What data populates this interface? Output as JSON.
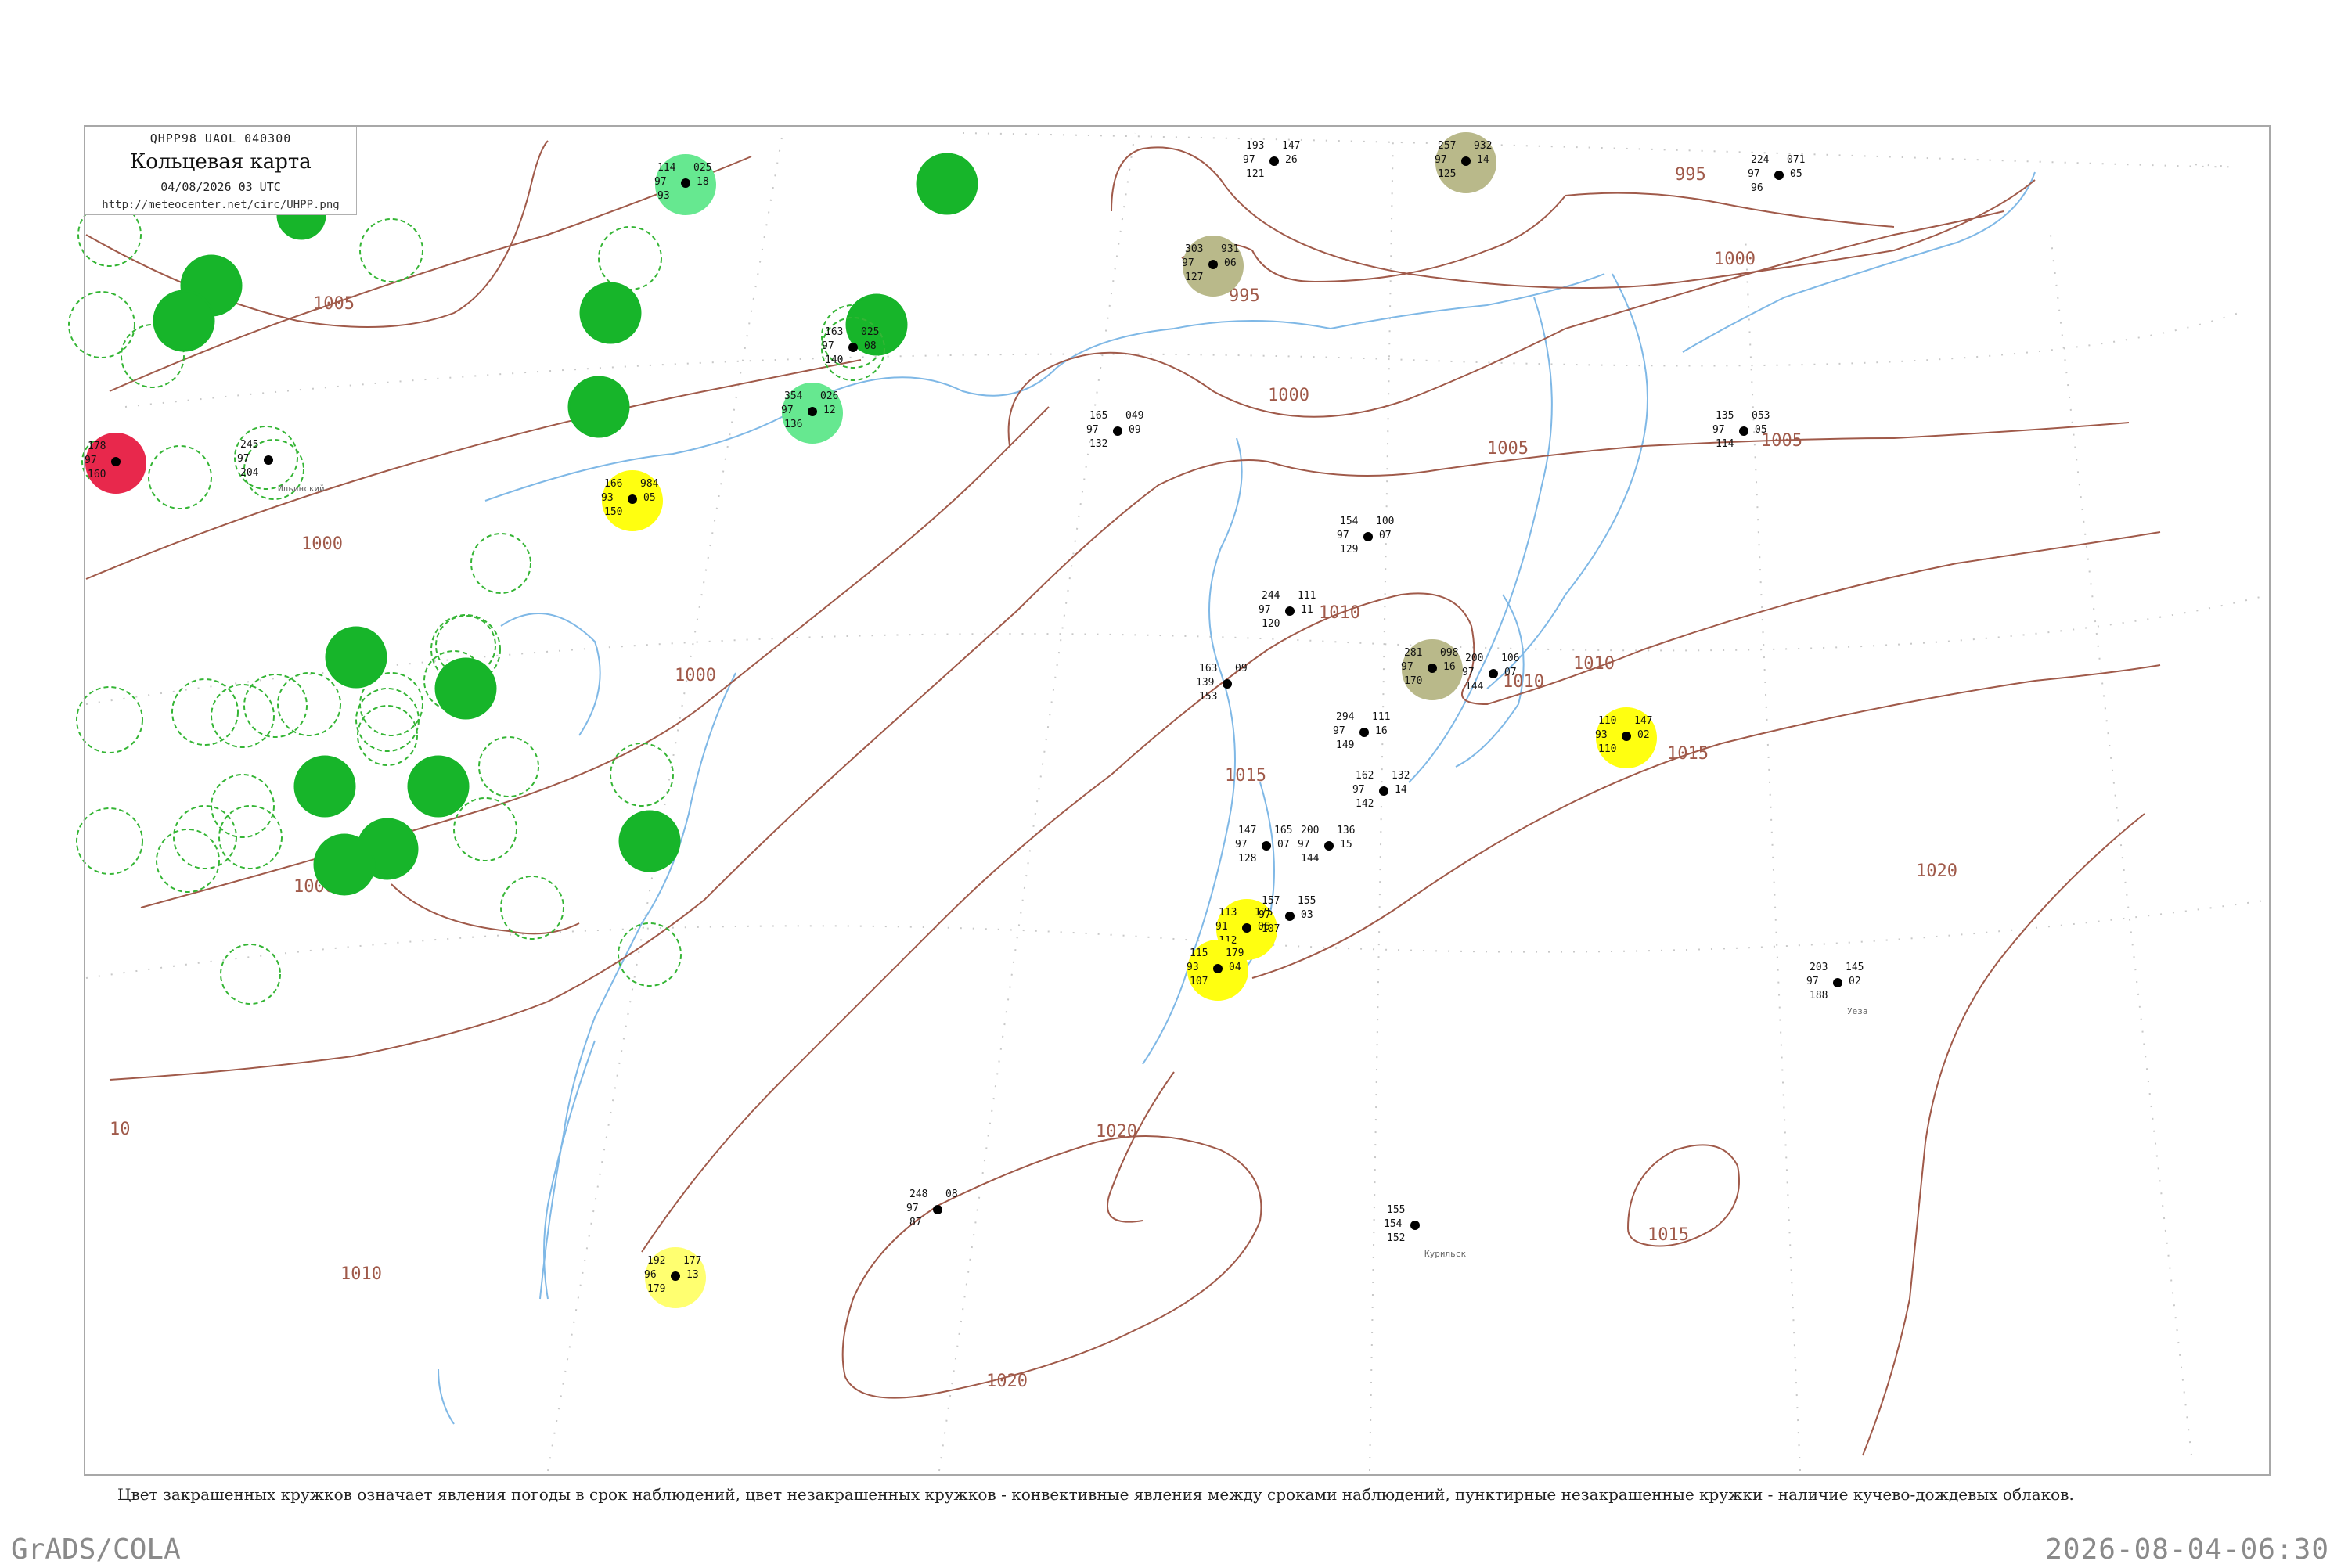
{
  "header": {
    "code_line": "QHPP98  UAOL  040300",
    "title": "Кольцевая карта",
    "datetime": "04/08/2026 03 UTC",
    "url": "http://meteocenter.net/circ/UHPP.png"
  },
  "caption": "Цвет закрашенных кружков означает явления погоды в срок наблюдений, цвет незакрашенных кружков - конвективные явления между сроками наблюдений, пунктирные незакрашенные кружки - наличие кучево-дождевых облаков.",
  "footer": {
    "software": "GrADS/COLA",
    "timestamp": "2026-08-04-06:30"
  },
  "colors": {
    "isobar": "#a05a4a",
    "water": "#7fb8e6",
    "green_fill": "#17b52a",
    "light_green_fill": "#66e890",
    "yellow_fill": "#ffff10",
    "light_yellow_fill": "#ffff70",
    "olive_fill": "#b9b98a",
    "red_fill": "#e8284c",
    "dashed_circle": "#35b535"
  },
  "isobar_labels": [
    {
      "text": "1005"
    },
    {
      "text": "1000"
    },
    {
      "text": "1000"
    },
    {
      "text": "995"
    },
    {
      "text": "995"
    },
    {
      "text": "1000"
    },
    {
      "text": "1000"
    },
    {
      "text": "1005"
    },
    {
      "text": "1005"
    },
    {
      "text": "1010"
    },
    {
      "text": "1010"
    },
    {
      "text": "1015"
    },
    {
      "text": "1015"
    },
    {
      "text": "1020"
    },
    {
      "text": "1020"
    },
    {
      "text": "1020"
    },
    {
      "text": "1015"
    },
    {
      "text": "1010"
    },
    {
      "text": "10"
    },
    {
      "text": "1000"
    },
    {
      "text": "1010"
    }
  ],
  "stations": [
    {
      "name": "Ильинский",
      "values": [
        "245",
        "97",
        "204"
      ],
      "style": "plain"
    },
    {
      "name": "",
      "values": [
        "114",
        "97",
        "93",
        "025",
        "18"
      ],
      "style": "green-light"
    },
    {
      "name": "",
      "values": [
        "163",
        "97",
        "140",
        "025",
        "08"
      ],
      "style": "dashed"
    },
    {
      "name": "",
      "values": [
        "354",
        "97",
        "136",
        "026",
        "12"
      ],
      "style": "green-light"
    },
    {
      "name": "",
      "values": [
        "166",
        "93",
        "150",
        "984",
        "05"
      ],
      "style": "yellow"
    },
    {
      "name": "",
      "values": [
        "257",
        "97",
        "125",
        "932",
        "14"
      ],
      "style": "olive"
    },
    {
      "name": "",
      "values": [
        "303",
        "97",
        "127",
        "931",
        "06"
      ],
      "style": "olive"
    },
    {
      "name": "",
      "values": [
        "281",
        "97",
        "170",
        "098",
        "16"
      ],
      "style": "olive"
    },
    {
      "name": "",
      "values": [
        "110",
        "93",
        "110",
        "147",
        "02"
      ],
      "style": "yellow"
    },
    {
      "name": "",
      "values": [
        "113",
        "91",
        "112",
        "175",
        "06"
      ],
      "style": "yellow"
    },
    {
      "name": "",
      "values": [
        "115",
        "93",
        "107",
        "179",
        "04"
      ],
      "style": "yellow"
    },
    {
      "name": "",
      "values": [
        "192",
        "96",
        "179",
        "177",
        "13"
      ],
      "style": "yellow-light"
    },
    {
      "name": "",
      "values": [
        "178",
        "97",
        "160"
      ],
      "style": "red"
    },
    {
      "name": "Уеза",
      "values": [
        "203",
        "97",
        "188",
        "145",
        "02"
      ],
      "style": "plain"
    },
    {
      "name": "Курильск",
      "values": [
        "155",
        "154",
        "152"
      ],
      "style": "plain"
    },
    {
      "name": "",
      "values": [
        "248",
        "97",
        "87",
        "08"
      ],
      "style": "plain"
    },
    {
      "name": "",
      "values": [
        "165",
        "97",
        "132",
        "049",
        "09"
      ],
      "style": "plain"
    },
    {
      "name": "",
      "values": [
        "135",
        "97",
        "114",
        "053",
        "05"
      ],
      "style": "plain"
    },
    {
      "name": "",
      "values": [
        "193",
        "97",
        "121",
        "147",
        "26"
      ],
      "style": "plain"
    },
    {
      "name": "",
      "values": [
        "224",
        "97",
        "96",
        "071",
        "05"
      ],
      "style": "plain"
    },
    {
      "name": "",
      "values": [
        "154",
        "97",
        "129",
        "100",
        "07"
      ],
      "style": "plain"
    },
    {
      "name": "",
      "values": [
        "244",
        "97",
        "120",
        "111",
        "11"
      ],
      "style": "plain"
    },
    {
      "name": "",
      "values": [
        "200",
        "97",
        "144",
        "106",
        "07"
      ],
      "style": "plain"
    },
    {
      "name": "",
      "values": [
        "294",
        "97",
        "149",
        "111",
        "16"
      ],
      "style": "plain"
    },
    {
      "name": "",
      "values": [
        "162",
        "97",
        "142",
        "132",
        "14"
      ],
      "style": "plain"
    },
    {
      "name": "",
      "values": [
        "200",
        "97",
        "144",
        "136",
        "15"
      ],
      "style": "plain"
    },
    {
      "name": "",
      "values": [
        "147",
        "97",
        "128",
        "165",
        "07"
      ],
      "style": "plain"
    },
    {
      "name": "",
      "values": [
        "157",
        "97",
        "107",
        "155",
        "03"
      ],
      "style": "plain"
    },
    {
      "name": "",
      "values": [
        "163",
        "139",
        "153",
        "09"
      ],
      "style": "plain"
    }
  ]
}
